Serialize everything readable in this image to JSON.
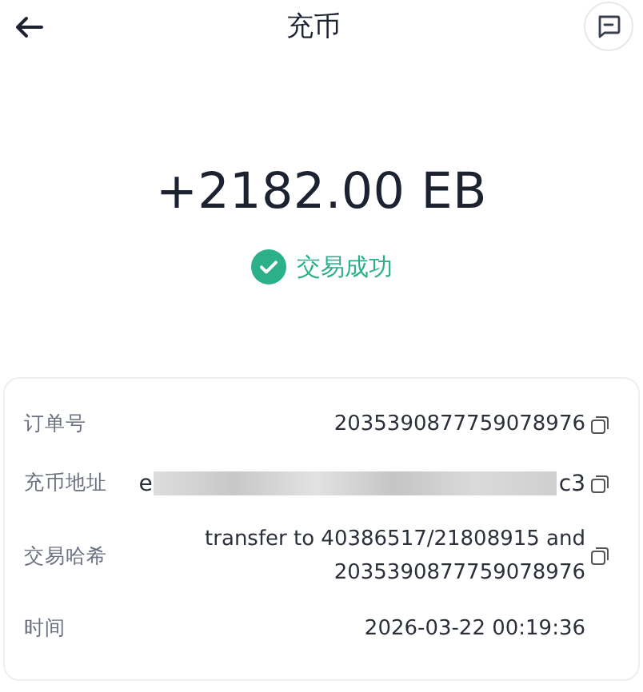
{
  "header": {
    "title": "充币"
  },
  "amount": "+2182.00 EB",
  "status": {
    "kind": "success",
    "label": "交易成功"
  },
  "details": [
    {
      "kind": "text",
      "label": "订单号",
      "value_lines": [
        "2035390877759078976"
      ],
      "copyable": true
    },
    {
      "kind": "redacted",
      "label": "充币地址",
      "value_start": "e",
      "value_end": "c3",
      "copyable": true
    },
    {
      "kind": "text",
      "label": "交易哈希",
      "value_lines": [
        "transfer to 40386517/21808915 and",
        "2035390877759078976"
      ],
      "copyable": true
    },
    {
      "kind": "text",
      "label": "时间",
      "value_lines": [
        "2026-03-22 00:19:36"
      ],
      "copyable": false
    }
  ]
}
